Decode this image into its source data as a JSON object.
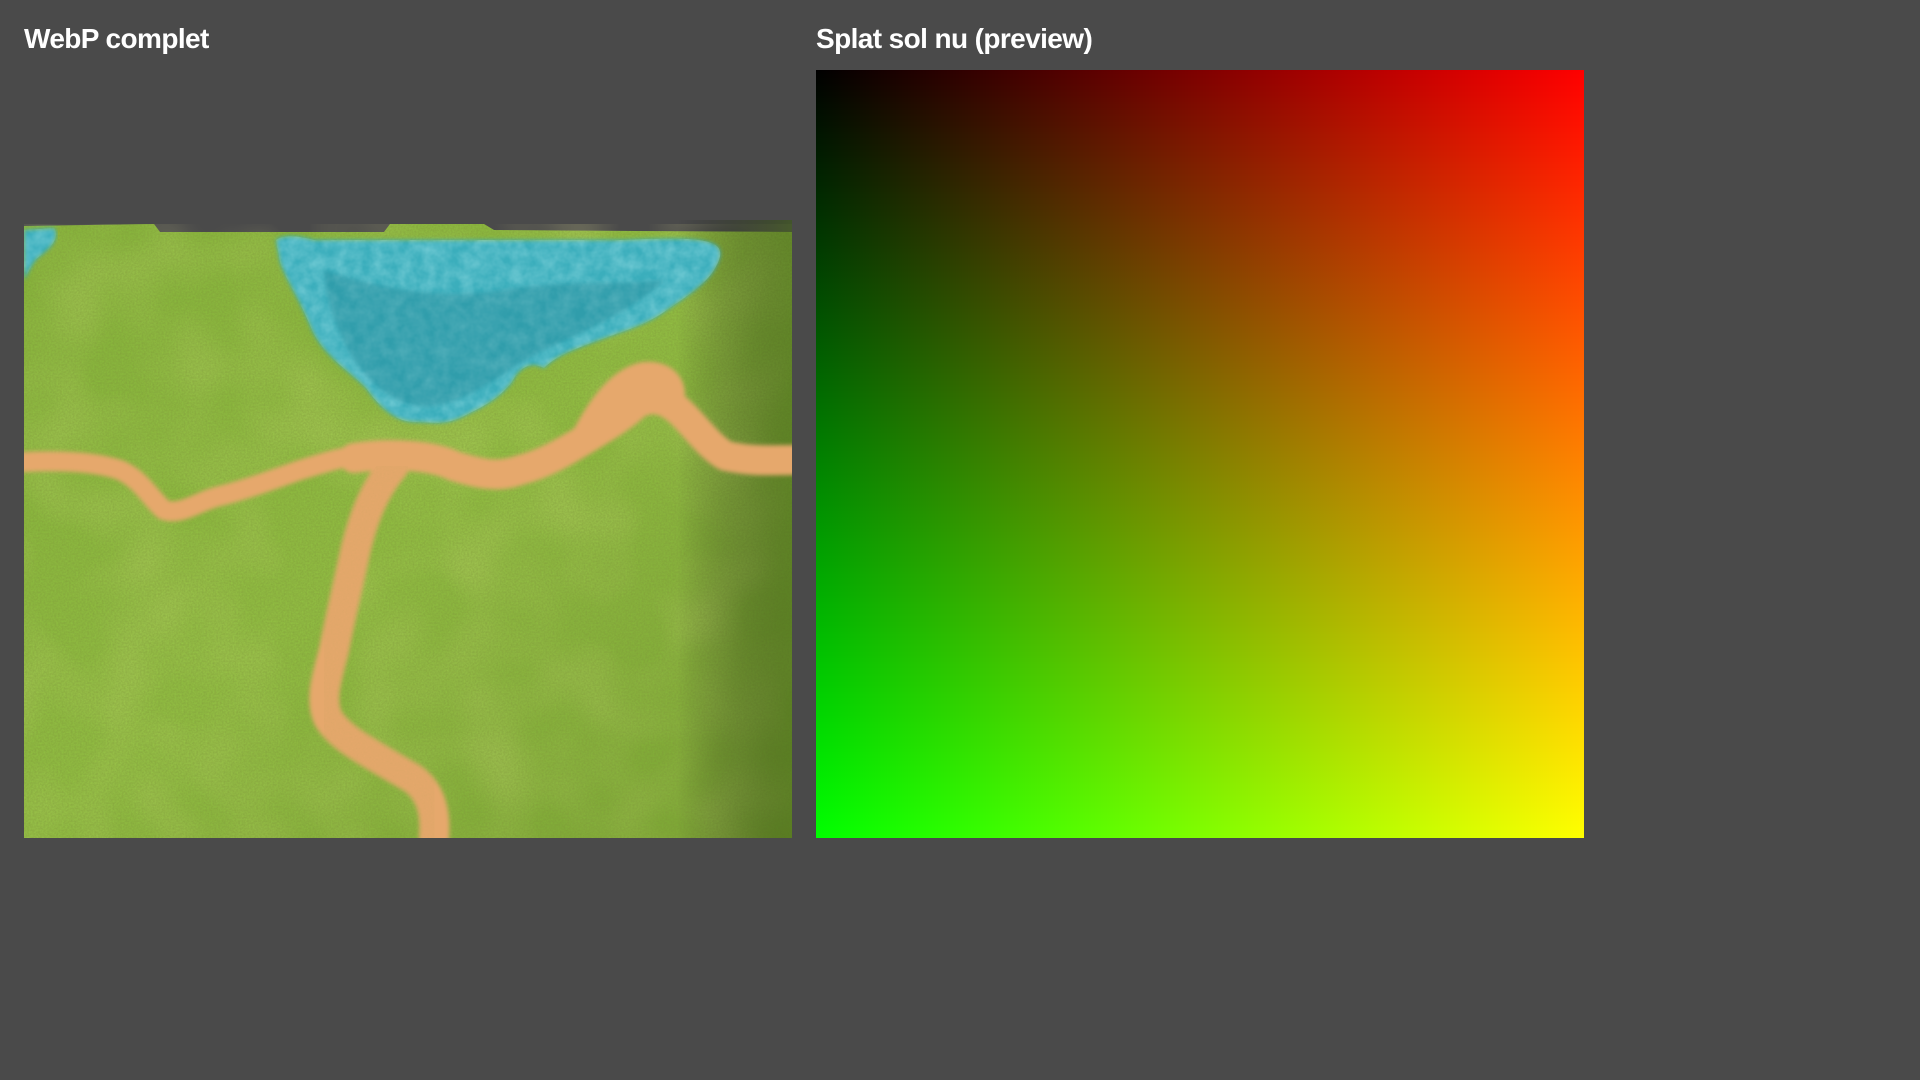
{
  "panels": {
    "left": {
      "title": "WebP complet"
    },
    "right": {
      "title": "Splat sol nu (preview)"
    }
  },
  "colors": {
    "background": "#4a4a4a",
    "grass": "#8fbd3a",
    "grass_dark": "#5f8f26",
    "path": "#e7ad72",
    "water": "#48b8c7",
    "water_dark": "#2d93a2"
  },
  "icons": {
    "terrain": "terrain-map-image",
    "splat": "splat-gradient-preview"
  }
}
